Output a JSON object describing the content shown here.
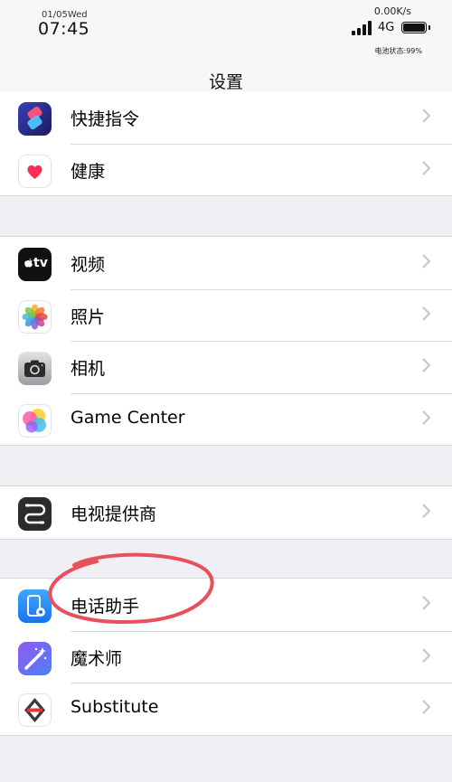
{
  "status_bar": {
    "date": "01/05Wed",
    "time": "07:45",
    "net_speed": "0.00K/s",
    "network_type": "4G",
    "battery_state": "电池状态:99%"
  },
  "nav": {
    "title": "设置"
  },
  "groups": [
    {
      "items": [
        {
          "label": "快捷指令",
          "icon": "shortcuts-icon"
        },
        {
          "label": "健康",
          "icon": "health-icon"
        }
      ]
    },
    {
      "items": [
        {
          "label": "视频",
          "icon": "apple-tv-icon"
        },
        {
          "label": "照片",
          "icon": "photos-icon"
        },
        {
          "label": "相机",
          "icon": "camera-icon"
        },
        {
          "label": "Game Center",
          "icon": "game-center-icon"
        }
      ]
    },
    {
      "items": [
        {
          "label": "电视提供商",
          "icon": "tv-provider-icon"
        }
      ]
    },
    {
      "items": [
        {
          "label": "电话助手",
          "icon": "phone-assistant-icon"
        },
        {
          "label": "魔术师",
          "icon": "magician-icon"
        },
        {
          "label": "Substitute",
          "icon": "substitute-icon"
        }
      ]
    }
  ],
  "icons": {
    "apple_tv_text": "tv"
  },
  "colors": {
    "background": "#efeff4",
    "chevron": "#c4c4c9",
    "annotation": "#e8505b"
  }
}
